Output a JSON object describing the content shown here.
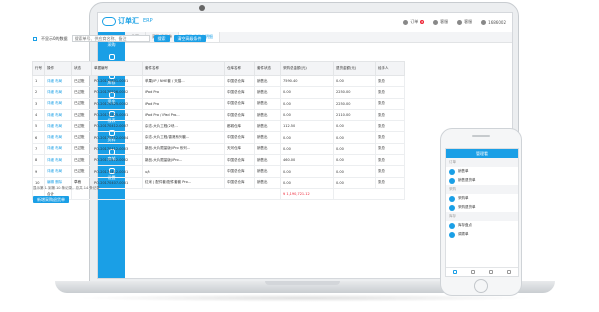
{
  "app": {
    "name": "订单汇",
    "suffix": "ERP"
  },
  "topbar": [
    {
      "label": "订单",
      "badge": "8"
    },
    {
      "label": "客服"
    },
    {
      "label": "客服"
    },
    {
      "label": "1686002"
    }
  ],
  "sidebar": [
    "采购",
    "销售",
    "库存",
    "资金",
    "报表",
    "资料",
    "商城",
    "设置"
  ],
  "tabs": [
    "首页",
    "采购退货单",
    "采购退货单明细"
  ],
  "filter": {
    "checkbox": "不显示0的数据",
    "placeholder": "搜索单号、供应商名称、备注",
    "search": "搜索",
    "clear": "清空高级条件"
  },
  "table": {
    "headers": [
      "行号",
      "操作",
      "状态",
      "单据编号",
      "套件名称",
      "仓库名称",
      "套件状态",
      "采购总金额(元)",
      "退货金额(元)",
      "经手人"
    ],
    "rows": [
      [
        "1",
        "详细 布局",
        "已过账",
        "PO-20170801-0001",
        "苹果(IP / NHE套 / 天猫...",
        "中国总仓库",
        "销售出",
        "7590.40",
        "0.00",
        "张总"
      ],
      [
        "2",
        "详细 布局",
        "已过账",
        "PO-20170526-0002",
        "iPad Pro",
        "中国总仓库",
        "销售出",
        "0.00",
        "2250.00",
        "张总"
      ],
      [
        "3",
        "详细 布局",
        "已过账",
        "PO-20170525-0002",
        "iPad Pro",
        "中国总仓库",
        "销售出",
        "0.00",
        "2250.00",
        "张总"
      ],
      [
        "4",
        "详细 布局",
        "已过账",
        "PO-20170525-0001",
        "iPad Pro / iPad Pro...",
        "中国总仓库",
        "销售出",
        "0.00",
        "2110.00",
        "张总"
      ],
      [
        "5",
        "详细 布局",
        "已过账",
        "PO-20170412-0007",
        "杂志-大片工程(2块...",
        "都城仓库",
        "销售出",
        "112.50",
        "0.00",
        "张总"
      ],
      [
        "6",
        "详细 布局",
        "已过账",
        "PO-20170412-0004",
        "杂志-大片工程/香港系列套...",
        "中国总仓库",
        "销售出",
        "0.00",
        "0.00",
        "张总"
      ],
      [
        "7",
        "详细 布局",
        "已过账",
        "PO-20170412-0003",
        "新品-大片限量版(iPro 系列...",
        "天河仓库",
        "销售出",
        "0.00",
        "0.00",
        "张总"
      ],
      [
        "8",
        "详细 布局",
        "已过账",
        "PO-20170412-0002",
        "新品-大片限量版(iPro...",
        "中国总仓库",
        "销售出",
        "460.00",
        "0.00",
        "张总"
      ],
      [
        "9",
        "详细 布局",
        "已过账",
        "PO-20170412-0001",
        "u/t",
        "中国总仓库",
        "销售出",
        "0.00",
        "0.00",
        "张总"
      ],
      [
        "10",
        "编辑 删除",
        "草稿",
        "PO-20170407-0001",
        "红米 | 配件套/配件套套 Pro...",
        "中国总仓库",
        "销售出",
        "0.00",
        "0.00",
        "张总"
      ]
    ],
    "total_label": "合计",
    "total_value": "¥ 1,190,721.12"
  },
  "pager": "显示第 1 到第 10 条记录，总共 14 条记录",
  "bottom_button": "新增采购退货单",
  "phone": {
    "title": "管理看",
    "sections": [
      {
        "title": "订单",
        "items": [
          "销售单",
          "销售退货单"
        ]
      },
      {
        "title": "采购",
        "items": [
          "采购单",
          "采购退货单"
        ]
      },
      {
        "title": "库存",
        "items": [
          "库存盘点",
          "调拨单"
        ]
      }
    ]
  }
}
